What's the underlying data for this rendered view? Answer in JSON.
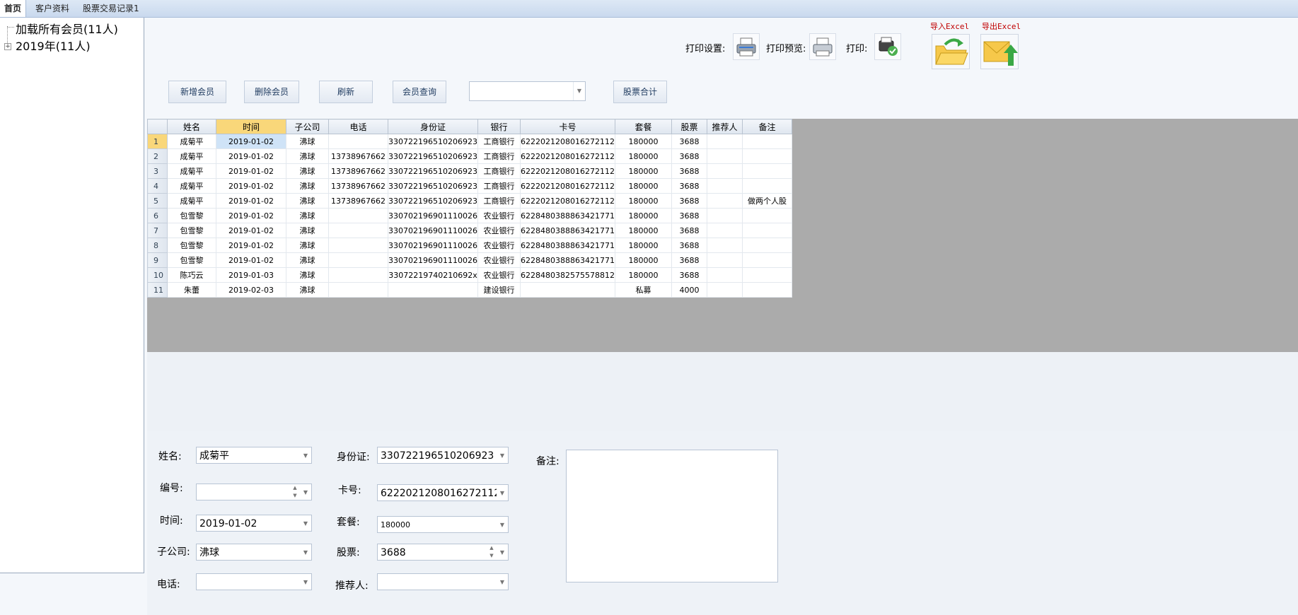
{
  "tabs": [
    {
      "label": "首页"
    },
    {
      "label": "客户资料"
    },
    {
      "label": "股票交易记录1"
    }
  ],
  "tree": {
    "root": "加载所有会员(11人)",
    "child": "2019年(11人)",
    "expander": "+"
  },
  "toolbar": {
    "print_setup": "打印设置:",
    "print_preview": "打印预览:",
    "print": "打印:",
    "import_excel": "导入Excel",
    "export_excel": "导出Excel"
  },
  "actions": {
    "add": "新增会员",
    "delete": "删除会员",
    "refresh": "刷新",
    "query": "会员查询",
    "query_combo": "",
    "total": "股票合计"
  },
  "grid": {
    "columns": [
      "姓名",
      "时间",
      "子公司",
      "电话",
      "身份证",
      "银行",
      "卡号",
      "套餐",
      "股票",
      "推荐人",
      "备注"
    ],
    "selected_column": 1,
    "rows": [
      {
        "n": "1",
        "c": [
          "成菊平",
          "2019-01-02",
          "沸球",
          "",
          "330722196510206923",
          "工商银行",
          "6222021208016272112",
          "180000",
          "3688",
          "",
          ""
        ]
      },
      {
        "n": "2",
        "c": [
          "成菊平",
          "2019-01-02",
          "沸球",
          "13738967662",
          "330722196510206923",
          "工商银行",
          "6222021208016272112",
          "180000",
          "3688",
          "",
          ""
        ]
      },
      {
        "n": "3",
        "c": [
          "成菊平",
          "2019-01-02",
          "沸球",
          "13738967662",
          "330722196510206923",
          "工商银行",
          "6222021208016272112",
          "180000",
          "3688",
          "",
          ""
        ]
      },
      {
        "n": "4",
        "c": [
          "成菊平",
          "2019-01-02",
          "沸球",
          "13738967662",
          "330722196510206923",
          "工商银行",
          "6222021208016272112",
          "180000",
          "3688",
          "",
          ""
        ]
      },
      {
        "n": "5",
        "c": [
          "成菊平",
          "2019-01-02",
          "沸球",
          "13738967662",
          "330722196510206923",
          "工商银行",
          "6222021208016272112",
          "180000",
          "3688",
          "",
          "做两个人股"
        ]
      },
      {
        "n": "6",
        "c": [
          "包雪黎",
          "2019-01-02",
          "沸球",
          "",
          "330702196901110026",
          "农业银行",
          "6228480388863421771",
          "180000",
          "3688",
          "",
          ""
        ]
      },
      {
        "n": "7",
        "c": [
          "包雪黎",
          "2019-01-02",
          "沸球",
          "",
          "330702196901110026",
          "农业银行",
          "6228480388863421771",
          "180000",
          "3688",
          "",
          ""
        ]
      },
      {
        "n": "8",
        "c": [
          "包雪黎",
          "2019-01-02",
          "沸球",
          "",
          "330702196901110026",
          "农业银行",
          "6228480388863421771",
          "180000",
          "3688",
          "",
          ""
        ]
      },
      {
        "n": "9",
        "c": [
          "包雪黎",
          "2019-01-02",
          "沸球",
          "",
          "330702196901110026",
          "农业银行",
          "6228480388863421771",
          "180000",
          "3688",
          "",
          ""
        ]
      },
      {
        "n": "10",
        "c": [
          "陈巧云",
          "2019-01-03",
          "沸球",
          "",
          "33072219740210692x",
          "农业银行",
          "6228480382575578812",
          "180000",
          "3688",
          "",
          ""
        ]
      },
      {
        "n": "11",
        "c": [
          "朱蕾",
          "2019-02-03",
          "沸球",
          "",
          "",
          "建设银行",
          "",
          "私募",
          "4000",
          "",
          ""
        ]
      }
    ]
  },
  "detail": {
    "name_label": "姓名:",
    "name_value": "成菊平",
    "id_label": "身份证:",
    "id_value": "330722196510206923",
    "memo_label": "备注:",
    "memo_value": "",
    "number_label": "编号:",
    "number_value": "",
    "card_label": "卡号:",
    "card_value": "6222021208016272112",
    "time_label": "时间:",
    "time_value": "2019-01-02",
    "package_label": "套餐:",
    "package_value": "180000",
    "company_label": "子公司:",
    "company_value": "沸球",
    "stock_label": "股票:",
    "stock_value": "3688",
    "phone_label": "电话:",
    "phone_value": "",
    "referrer_label": "推荐人:",
    "referrer_value": ""
  }
}
